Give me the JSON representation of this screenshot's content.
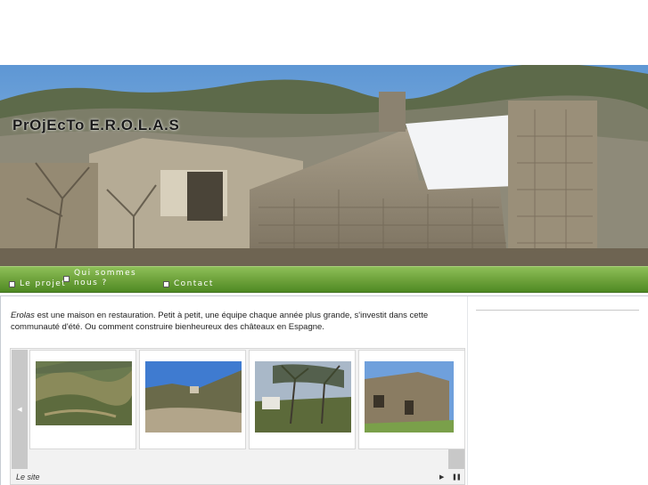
{
  "header": {
    "site_title": "PrOjEcTo E.R.O.L.A.S"
  },
  "nav": {
    "items": [
      {
        "label": "Le projet"
      },
      {
        "label": "Qui sommes nous ?"
      },
      {
        "label": "Contact"
      }
    ]
  },
  "intro": {
    "name": "Erolas",
    "text": " est une maison en restauration. Petit à petit, une équipe chaque année plus grande, s'investit dans cette communauté d'été. Ou comment construire bienheureux des châteaux en Espagne."
  },
  "gallery": {
    "prev_icon": "triangle-left-icon",
    "next_icon": "triangle-right-icon",
    "caption": "Le site",
    "controls": {
      "play_icon": "play-icon",
      "pause_icon": "pause-icon"
    }
  },
  "colors": {
    "nav_green": "#6fa33c",
    "text": "#222222"
  }
}
